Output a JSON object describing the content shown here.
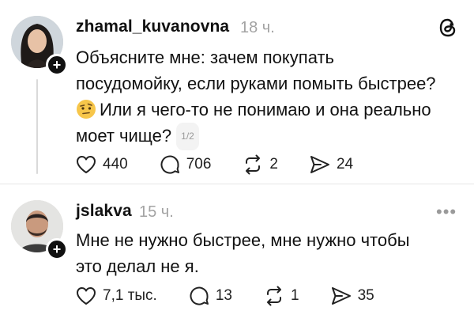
{
  "posts": [
    {
      "username": "zhamal_kuvanovna",
      "time": "18 ч.",
      "lines": [
        "Объясните мне: зачем покупать",
        "посудомойку, если руками помыть быстрее?",
        "Или я чего-то не понимаю и она реально",
        "моет чище?"
      ],
      "page_indicator": "1/2",
      "actions": {
        "likes": "440",
        "replies": "706",
        "reposts": "2",
        "shares": "24"
      }
    },
    {
      "username": "jslakva",
      "time": "15 ч.",
      "lines": [
        "Мне не нужно быстрее, мне нужно чтобы",
        "это делал не я."
      ],
      "actions": {
        "likes": "7,1 тыс.",
        "replies": "13",
        "reposts": "1",
        "shares": "35"
      }
    }
  ],
  "icons": {
    "app_logo": "threads-logo-icon",
    "more": "more-options-icon",
    "emoji": "face-with-raised-eyebrow-emoji",
    "like": "heart-icon",
    "reply": "comment-icon",
    "repost": "repost-icon",
    "share": "share-icon",
    "follow": "plus-icon"
  },
  "more_text": "•••",
  "follow_text": "+"
}
